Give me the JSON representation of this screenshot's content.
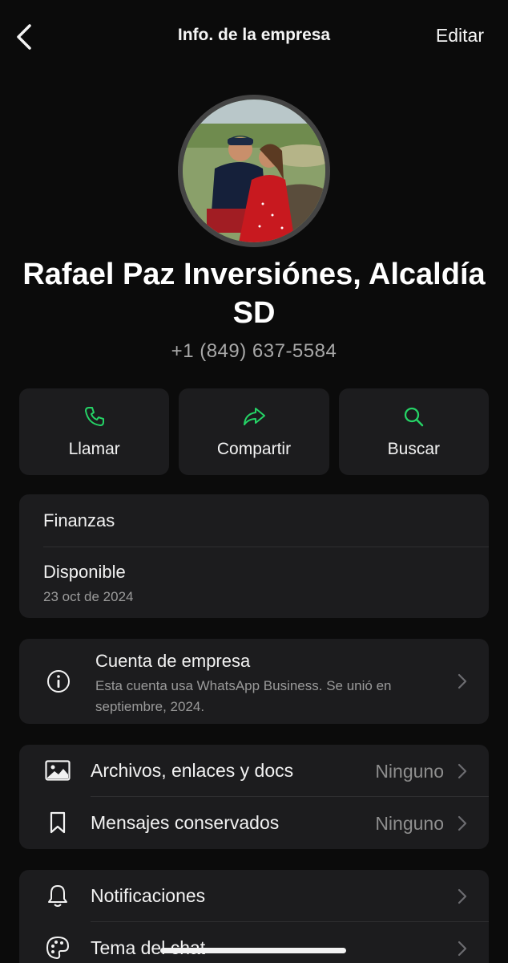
{
  "header": {
    "title": "Info. de la empresa",
    "edit_label": "Editar"
  },
  "profile": {
    "name": "Rafael Paz Inversiónes, Alcaldía  SD",
    "phone": "+1 (849) 637-5584"
  },
  "actions": [
    {
      "label": "Llamar",
      "icon": "phone-icon"
    },
    {
      "label": "Compartir",
      "icon": "share-icon"
    },
    {
      "label": "Buscar",
      "icon": "search-icon"
    }
  ],
  "about": {
    "category": "Finanzas",
    "status": "Disponible",
    "date": "23 oct de 2024"
  },
  "business_account": {
    "title": "Cuenta de empresa",
    "description": "Esta cuenta usa WhatsApp Business. Se unió en septiembre, 2024."
  },
  "media": {
    "files_label": "Archivos, enlaces y docs",
    "files_value": "Ninguno",
    "starred_label": "Mensajes conservados",
    "starred_value": "Ninguno"
  },
  "settings": {
    "notifications_label": "Notificaciones",
    "theme_label": "Tema del chat"
  },
  "colors": {
    "accent": "#25d366",
    "background": "#0b0b0b",
    "card": "#1c1c1e",
    "secondary_text": "#9a9a9a"
  }
}
